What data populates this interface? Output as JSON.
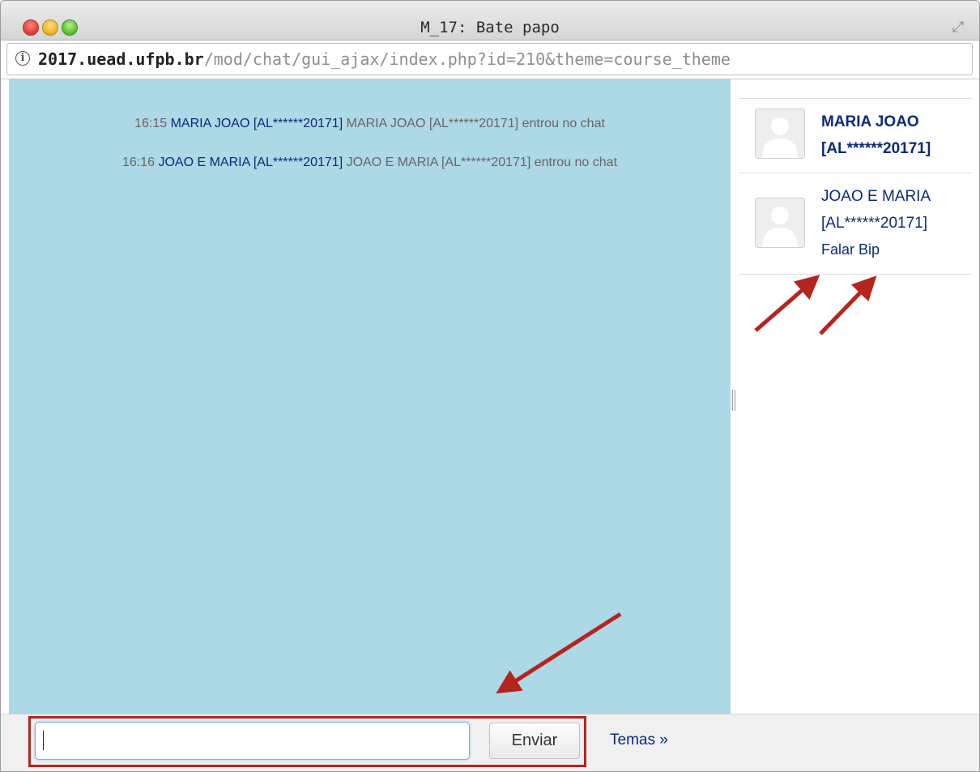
{
  "window": {
    "title": "M_17: Bate papo"
  },
  "address": {
    "host": "2017.uead.ufpb.br",
    "path": "/mod/chat/gui_ajax/index.php?id=210&theme=course_theme"
  },
  "messages": [
    {
      "time": "16:15",
      "user": "MARIA JOAO [AL******20171]",
      "text": "MARIA JOAO [AL******20171] entrou no chat"
    },
    {
      "time": "16:16",
      "user": "JOAO E MARIA [AL******20171]",
      "text": "JOAO E MARIA [AL******20171] entrou no chat"
    }
  ],
  "users": [
    {
      "name_line1": "MARIA JOAO",
      "name_line2": "[AL******20171]"
    },
    {
      "name_line1": "JOAO E MARIA",
      "name_line2": "[AL******20171]",
      "actions": {
        "talk": "Falar",
        "beep": "Bip"
      }
    }
  ],
  "composer": {
    "value": "",
    "send_label": "Enviar",
    "themes_label": "Temas »"
  },
  "colors": {
    "chat_bg": "#add8e6",
    "link": "#0b2a7a",
    "annotation_arrow": "#b6241e"
  }
}
